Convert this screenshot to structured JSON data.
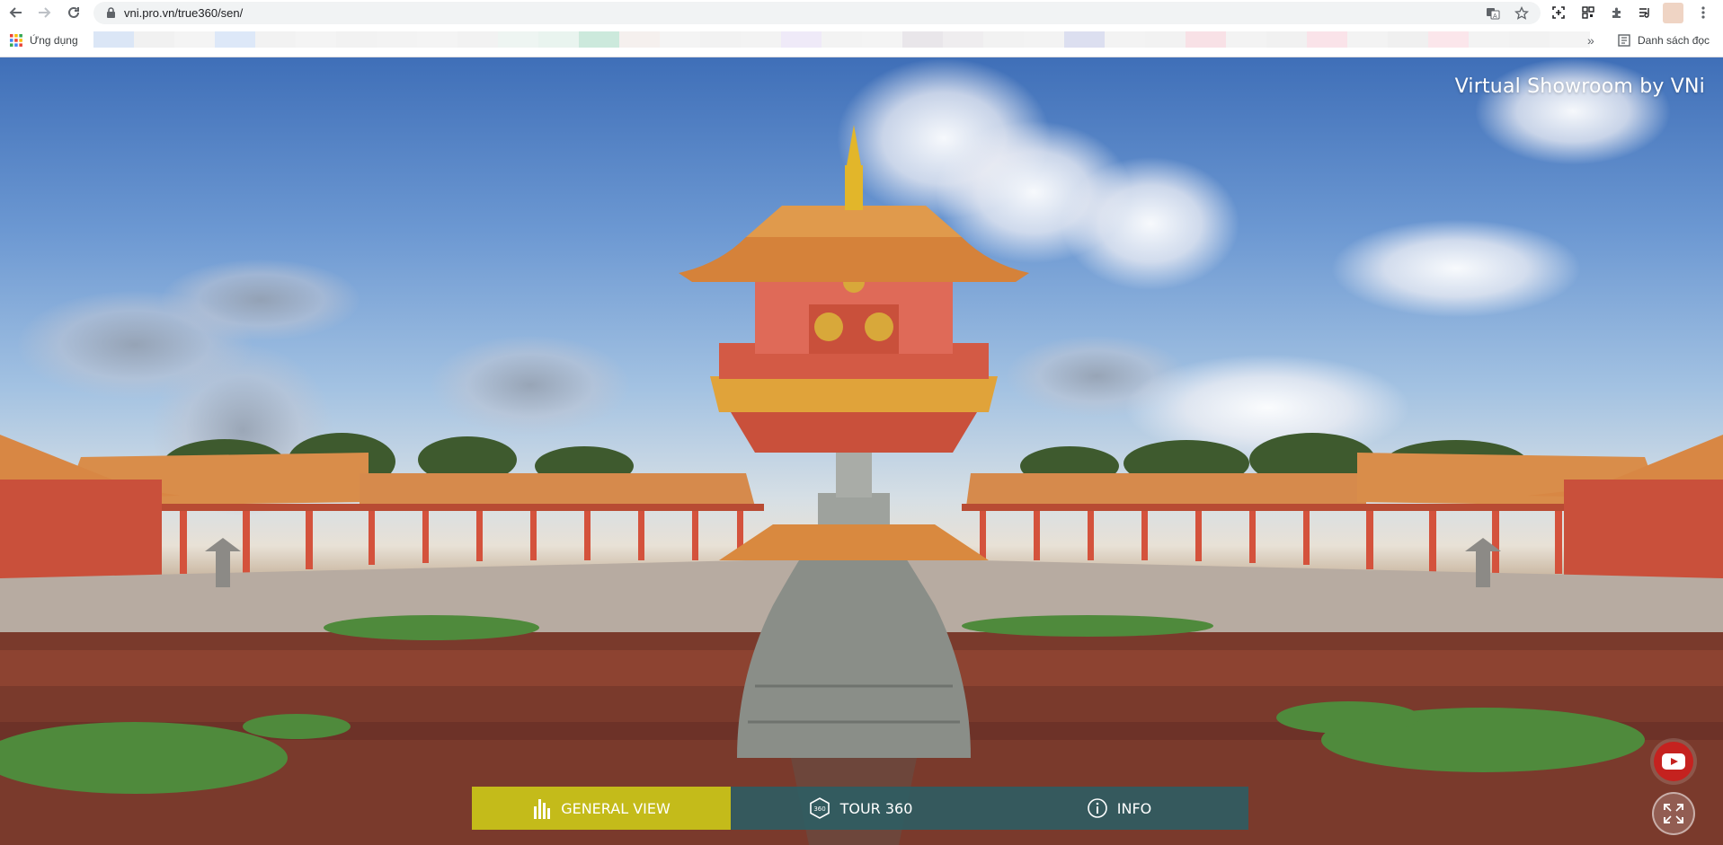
{
  "browser": {
    "url": "vni.pro.vn/true360/sen/",
    "apps_label": "Ứng dụng",
    "reading_list_label": "Danh sách đọc",
    "more_bookmarks": "»",
    "bookmark_swatches": [
      "#dbe6f6",
      "#f1f1f1",
      "#f4f4f4",
      "#dde8f8",
      "#f2f2f2",
      "#f4f4f4",
      "#f2f2f2",
      "#f3f3f3",
      "#f4f4f4",
      "#f2f2f2",
      "#eef5f2",
      "#e9f4ef",
      "#cce9dc",
      "#f5f0ee",
      "#f4f4f4",
      "#f2f2f2",
      "#f3f3f3",
      "#efeaf8",
      "#f3f3f3",
      "#f4f4f4",
      "#e9e6ea",
      "#efedef",
      "#f2f2f2",
      "#f3f3f3",
      "#dcdff0",
      "#f3f3f3",
      "#f2f2f2",
      "#f8e1e6",
      "#f3f3f3",
      "#f1f1f1",
      "#fae3e9",
      "#f3f3f3",
      "#f0f0f0",
      "#fbe6eb",
      "#f3f3f3",
      "#f2f2f2",
      "#f4f4f4"
    ]
  },
  "viewer": {
    "brand": "Virtual Showroom by VNi",
    "nav": [
      {
        "label": "GENERAL VIEW",
        "icon": "building-icon",
        "active": true
      },
      {
        "label": "TOUR 360",
        "icon": "360-icon",
        "active": false
      },
      {
        "label": "INFO",
        "icon": "info-icon",
        "active": false
      }
    ],
    "youtube_icon": "youtube-icon",
    "fullscreen_icon": "expand-icon"
  },
  "colors": {
    "active_nav": "#c4bb1a",
    "nav_bg": "#266068",
    "youtube": "#c5221f"
  }
}
